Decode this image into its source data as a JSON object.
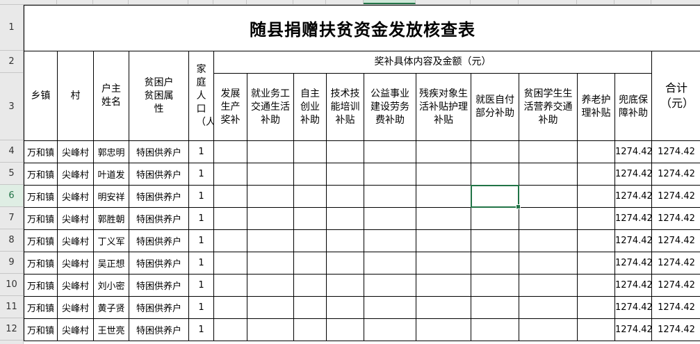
{
  "spreadsheet": {
    "title": "随县捐赠扶贫资金发放核查表",
    "row_numbers": [
      "1",
      "2",
      "3",
      "4",
      "5",
      "6",
      "7",
      "8",
      "9",
      "10",
      "11",
      "12"
    ],
    "selected_row": "6",
    "headers": {
      "town": "乡镇",
      "village": "村",
      "householder": "户主姓名",
      "poverty_attr": "贫困户贫困属性",
      "family_size": "家庭人口（人）",
      "subsidy_group": "奖补具体内容及金额（元）",
      "subsidies": [
        "发展生产奖补",
        "就业务工交通生活补助",
        "自主创业补助",
        "技术技能培训补贴",
        "公益事业建设劳务费补助",
        "残疾对象生活补贴护理补贴",
        "就医自付部分补助",
        "贫困学生生活营养交通补助",
        "养老护理补贴",
        "兜底保障补助"
      ],
      "total": "合计（元）"
    },
    "rows": [
      {
        "town": "万和镇",
        "village": "尖峰村",
        "name": "郭忠明",
        "attr": "特困供养户",
        "size": "1",
        "subsidies": [
          "",
          "",
          "",
          "",
          "",
          "",
          "",
          "",
          "",
          "1274.42"
        ],
        "total": "1274.42"
      },
      {
        "town": "万和镇",
        "village": "尖峰村",
        "name": "叶道发",
        "attr": "特困供养户",
        "size": "1",
        "subsidies": [
          "",
          "",
          "",
          "",
          "",
          "",
          "",
          "",
          "",
          "1274.42"
        ],
        "total": "1274.42"
      },
      {
        "town": "万和镇",
        "village": "尖峰村",
        "name": "明安祥",
        "attr": "特困供养户",
        "size": "1",
        "subsidies": [
          "",
          "",
          "",
          "",
          "",
          "",
          "",
          "",
          "",
          "1274.42"
        ],
        "total": "1274.42"
      },
      {
        "town": "万和镇",
        "village": "尖峰村",
        "name": "郭胜朝",
        "attr": "特困供养户",
        "size": "1",
        "subsidies": [
          "",
          "",
          "",
          "",
          "",
          "",
          "",
          "",
          "",
          "1274.42"
        ],
        "total": "1274.42"
      },
      {
        "town": "万和镇",
        "village": "尖峰村",
        "name": "丁义军",
        "attr": "特困供养户",
        "size": "1",
        "subsidies": [
          "",
          "",
          "",
          "",
          "",
          "",
          "",
          "",
          "",
          "1274.42"
        ],
        "total": "1274.42"
      },
      {
        "town": "万和镇",
        "village": "尖峰村",
        "name": "吴正想",
        "attr": "特困供养户",
        "size": "1",
        "subsidies": [
          "",
          "",
          "",
          "",
          "",
          "",
          "",
          "",
          "",
          "1274.42"
        ],
        "total": "1274.42"
      },
      {
        "town": "万和镇",
        "village": "尖峰村",
        "name": "刘小密",
        "attr": "特困供养户",
        "size": "1",
        "subsidies": [
          "",
          "",
          "",
          "",
          "",
          "",
          "",
          "",
          "",
          "1274.42"
        ],
        "total": "1274.42"
      },
      {
        "town": "万和镇",
        "village": "尖峰村",
        "name": "黄子贤",
        "attr": "特困供养户",
        "size": "1",
        "subsidies": [
          "",
          "",
          "",
          "",
          "",
          "",
          "",
          "",
          "",
          "1274.42"
        ],
        "total": "1274.42"
      },
      {
        "town": "万和镇",
        "village": "尖峰村",
        "name": "王世亮",
        "attr": "特困供养户",
        "size": "1",
        "subsidies": [
          "",
          "",
          "",
          "",
          "",
          "",
          "",
          "",
          "",
          "1274.42"
        ],
        "total": "1274.42"
      }
    ],
    "colors": {
      "selection": "#217346",
      "header_bg": "#e9e9e9",
      "grid": "#c6c6c6"
    }
  }
}
